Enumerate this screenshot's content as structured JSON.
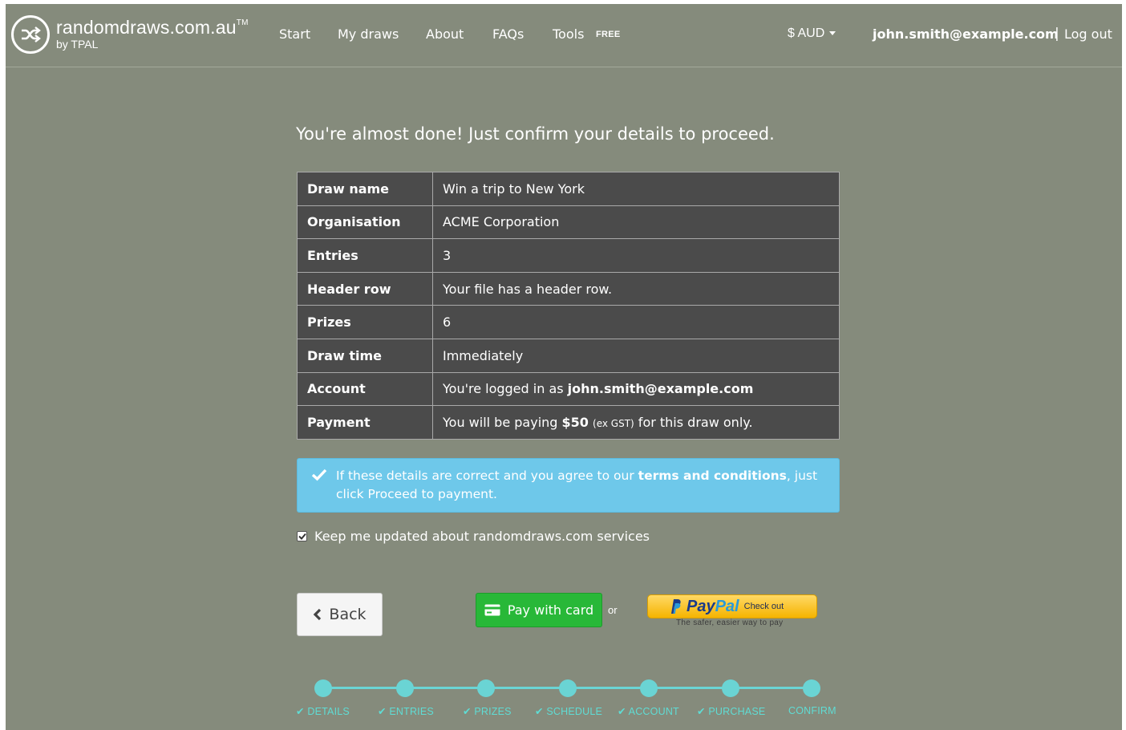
{
  "brand": {
    "name": "randomdraws.com.au",
    "trademark": "TM",
    "sub": "by TPAL",
    "icon": "shuffle-icon"
  },
  "nav": {
    "start": "Start",
    "my_draws": "My draws",
    "about": "About",
    "faqs": "FAQs",
    "tools": "Tools",
    "tools_badge": "FREE",
    "currency": "$ AUD",
    "user_email": "john.smith@example.com",
    "separator": "|",
    "logout": "Log out"
  },
  "heading": "You're almost done! Just confirm your details to proceed.",
  "details": [
    {
      "label": "Draw name",
      "value": "Win a trip to New York"
    },
    {
      "label": "Organisation",
      "value": "ACME Corporation"
    },
    {
      "label": "Entries",
      "value": "3"
    },
    {
      "label": "Header row",
      "value": "Your file has a header row."
    },
    {
      "label": "Prizes",
      "value": "6"
    },
    {
      "label": "Draw time",
      "value": "Immediately"
    },
    {
      "label": "Account",
      "value_prefix": "You're logged in as ",
      "value_bold": "john.smith@example.com"
    },
    {
      "label": "Payment",
      "value_prefix": "You will be paying ",
      "value_bold": "$50",
      "value_small": "(ex GST)",
      "value_suffix": " for this draw only."
    }
  ],
  "alert": {
    "icon": "check-icon",
    "text_prefix": "If these details are correct and you agree to our ",
    "link": "terms and conditions",
    "text_suffix": ", just click Proceed to payment."
  },
  "newsletter": {
    "checked": true,
    "label": "Keep me updated about randomdraws.com services"
  },
  "buttons": {
    "back": "Back",
    "pay_card": "Pay with card",
    "or": "or",
    "paypal_pay": "Pay",
    "paypal_pal": "Pal",
    "paypal_checkout": "Check out",
    "paypal_tagline": "The safer, easier way to pay"
  },
  "steps": [
    {
      "label": "DETAILS",
      "done": true
    },
    {
      "label": "ENTRIES",
      "done": true
    },
    {
      "label": "PRIZES",
      "done": true
    },
    {
      "label": "SCHEDULE",
      "done": true
    },
    {
      "label": "ACCOUNT",
      "done": true
    },
    {
      "label": "PURCHASE",
      "done": true
    },
    {
      "label": "CONFIRM",
      "done": false
    }
  ],
  "colors": {
    "background": "#858b7c",
    "table_bg": "#4b4b4b",
    "alert_bg": "#6ec8ea",
    "card_button": "#28b838",
    "paypal_button": "#f5b400",
    "progress": "#6ad4d4"
  }
}
